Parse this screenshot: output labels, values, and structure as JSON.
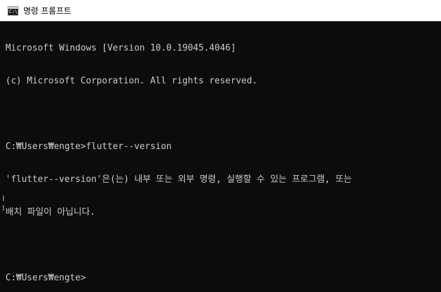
{
  "window": {
    "title": "명령 프롬프트",
    "icon": "cmd-icon",
    "icon_text": "C:\\"
  },
  "console": {
    "lines": [
      "Microsoft Windows [Version 10.0.19045.4046]",
      "(c) Microsoft Corporation. All rights reserved.",
      "",
      "C:₩Users₩engte>flutter--version",
      "'flutter--version'은(는) 내부 또는 외부 명령, 실행할 수 있는 프로그램, 또는",
      "배치 파일이 아닙니다.",
      "",
      "C:₩Users₩engte>"
    ]
  },
  "colors": {
    "console_bg": "#0c0c0c",
    "console_fg": "#cccccc",
    "titlebar_bg": "#ffffff"
  }
}
